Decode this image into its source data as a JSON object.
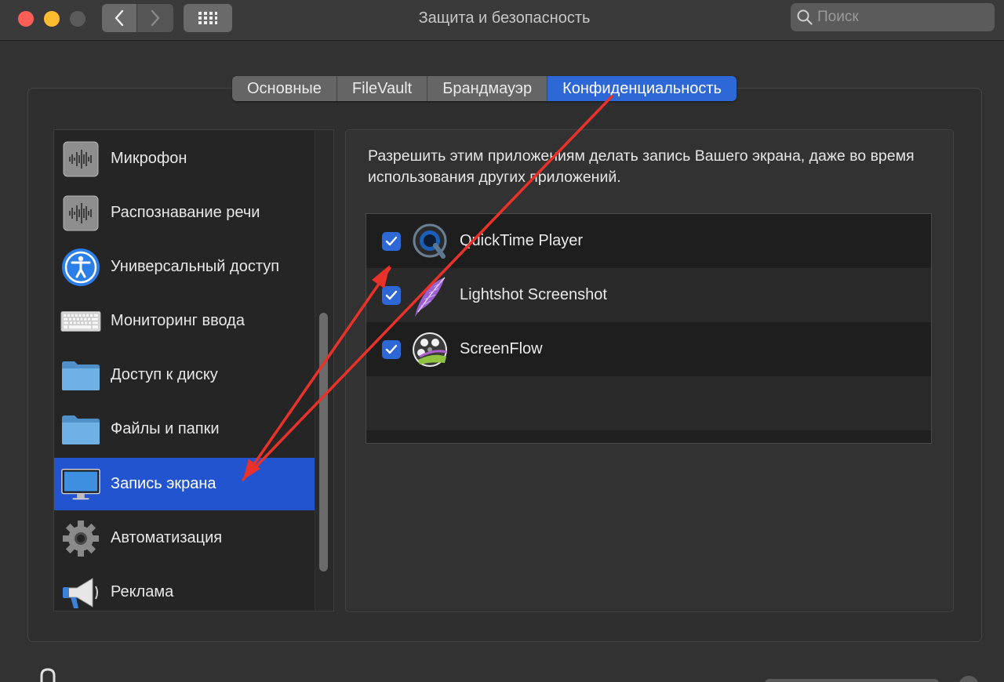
{
  "window": {
    "title": "Защита и безопасность",
    "search_placeholder": "Поиск"
  },
  "tabs": [
    {
      "label": "Основные",
      "active": false
    },
    {
      "label": "FileVault",
      "active": false
    },
    {
      "label": "Брандмауэр",
      "active": false
    },
    {
      "label": "Конфиденциальность",
      "active": true
    }
  ],
  "sidebar": {
    "items": [
      {
        "label": "Микрофон",
        "icon": "microphone-icon",
        "selected": false
      },
      {
        "label": "Распознавание речи",
        "icon": "speech-recognition-icon",
        "selected": false
      },
      {
        "label": "Универсальный доступ",
        "icon": "accessibility-icon",
        "selected": false
      },
      {
        "label": "Мониторинг ввода",
        "icon": "keyboard-icon",
        "selected": false
      },
      {
        "label": "Доступ к диску",
        "icon": "folder-icon",
        "selected": false
      },
      {
        "label": "Файлы и папки",
        "icon": "folder-icon",
        "selected": false
      },
      {
        "label": "Запись экрана",
        "icon": "display-icon",
        "selected": true
      },
      {
        "label": "Автоматизация",
        "icon": "gear-icon",
        "selected": false
      },
      {
        "label": "Реклама",
        "icon": "megaphone-icon",
        "selected": false
      }
    ]
  },
  "content": {
    "description": "Разрешить этим приложениям делать запись Вашего экрана, даже во время использования других приложений.",
    "apps": [
      {
        "label": "QuickTime Player",
        "checked": true,
        "icon": "quicktime-icon"
      },
      {
        "label": "Lightshot Screenshot",
        "checked": true,
        "icon": "lightshot-feather-icon"
      },
      {
        "label": "ScreenFlow",
        "checked": true,
        "icon": "screenflow-icon"
      }
    ]
  },
  "colors": {
    "accent": "#2e67d6",
    "annotation": "#e8322a"
  }
}
